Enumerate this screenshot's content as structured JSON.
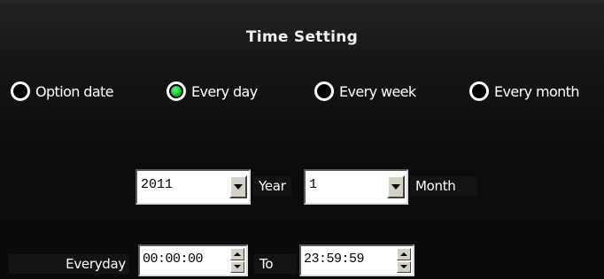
{
  "dialog": {
    "title": "Time Setting"
  },
  "schedule_options": {
    "selected": "Every day",
    "items": [
      {
        "label": "Option date",
        "checked": false
      },
      {
        "label": "Every day",
        "checked": true
      },
      {
        "label": "Every week",
        "checked": false
      },
      {
        "label": "Every month",
        "checked": false
      }
    ]
  },
  "date_row": {
    "year_value": "2011",
    "year_label": "Year",
    "month_value": "1",
    "month_label": "Month"
  },
  "time_row": {
    "everyday_label": "Everyday",
    "start_time": "00:00:00",
    "to_label": "To",
    "end_time": "23:59:59"
  },
  "colors": {
    "selected_radio": "#13c83a",
    "background": "#000000"
  }
}
